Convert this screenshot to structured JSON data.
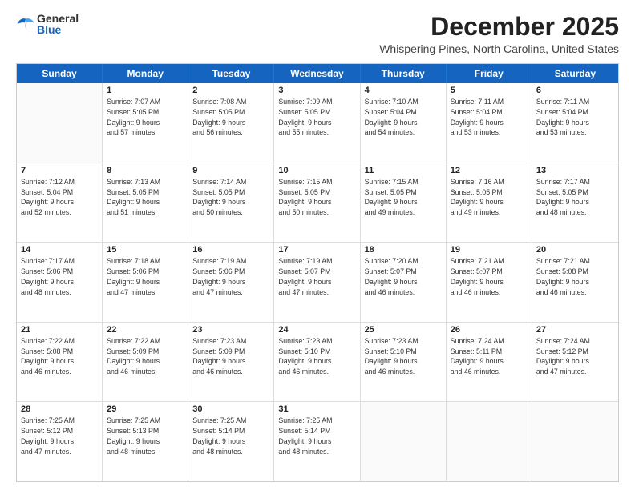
{
  "logo": {
    "general": "General",
    "blue": "Blue"
  },
  "title": "December 2025",
  "location": "Whispering Pines, North Carolina, United States",
  "days_of_week": [
    "Sunday",
    "Monday",
    "Tuesday",
    "Wednesday",
    "Thursday",
    "Friday",
    "Saturday"
  ],
  "weeks": [
    [
      {
        "day": "",
        "info": ""
      },
      {
        "day": "1",
        "info": "Sunrise: 7:07 AM\nSunset: 5:05 PM\nDaylight: 9 hours\nand 57 minutes."
      },
      {
        "day": "2",
        "info": "Sunrise: 7:08 AM\nSunset: 5:05 PM\nDaylight: 9 hours\nand 56 minutes."
      },
      {
        "day": "3",
        "info": "Sunrise: 7:09 AM\nSunset: 5:05 PM\nDaylight: 9 hours\nand 55 minutes."
      },
      {
        "day": "4",
        "info": "Sunrise: 7:10 AM\nSunset: 5:04 PM\nDaylight: 9 hours\nand 54 minutes."
      },
      {
        "day": "5",
        "info": "Sunrise: 7:11 AM\nSunset: 5:04 PM\nDaylight: 9 hours\nand 53 minutes."
      },
      {
        "day": "6",
        "info": "Sunrise: 7:11 AM\nSunset: 5:04 PM\nDaylight: 9 hours\nand 53 minutes."
      }
    ],
    [
      {
        "day": "7",
        "info": "Sunrise: 7:12 AM\nSunset: 5:04 PM\nDaylight: 9 hours\nand 52 minutes."
      },
      {
        "day": "8",
        "info": "Sunrise: 7:13 AM\nSunset: 5:05 PM\nDaylight: 9 hours\nand 51 minutes."
      },
      {
        "day": "9",
        "info": "Sunrise: 7:14 AM\nSunset: 5:05 PM\nDaylight: 9 hours\nand 50 minutes."
      },
      {
        "day": "10",
        "info": "Sunrise: 7:15 AM\nSunset: 5:05 PM\nDaylight: 9 hours\nand 50 minutes."
      },
      {
        "day": "11",
        "info": "Sunrise: 7:15 AM\nSunset: 5:05 PM\nDaylight: 9 hours\nand 49 minutes."
      },
      {
        "day": "12",
        "info": "Sunrise: 7:16 AM\nSunset: 5:05 PM\nDaylight: 9 hours\nand 49 minutes."
      },
      {
        "day": "13",
        "info": "Sunrise: 7:17 AM\nSunset: 5:05 PM\nDaylight: 9 hours\nand 48 minutes."
      }
    ],
    [
      {
        "day": "14",
        "info": "Sunrise: 7:17 AM\nSunset: 5:06 PM\nDaylight: 9 hours\nand 48 minutes."
      },
      {
        "day": "15",
        "info": "Sunrise: 7:18 AM\nSunset: 5:06 PM\nDaylight: 9 hours\nand 47 minutes."
      },
      {
        "day": "16",
        "info": "Sunrise: 7:19 AM\nSunset: 5:06 PM\nDaylight: 9 hours\nand 47 minutes."
      },
      {
        "day": "17",
        "info": "Sunrise: 7:19 AM\nSunset: 5:07 PM\nDaylight: 9 hours\nand 47 minutes."
      },
      {
        "day": "18",
        "info": "Sunrise: 7:20 AM\nSunset: 5:07 PM\nDaylight: 9 hours\nand 46 minutes."
      },
      {
        "day": "19",
        "info": "Sunrise: 7:21 AM\nSunset: 5:07 PM\nDaylight: 9 hours\nand 46 minutes."
      },
      {
        "day": "20",
        "info": "Sunrise: 7:21 AM\nSunset: 5:08 PM\nDaylight: 9 hours\nand 46 minutes."
      }
    ],
    [
      {
        "day": "21",
        "info": "Sunrise: 7:22 AM\nSunset: 5:08 PM\nDaylight: 9 hours\nand 46 minutes."
      },
      {
        "day": "22",
        "info": "Sunrise: 7:22 AM\nSunset: 5:09 PM\nDaylight: 9 hours\nand 46 minutes."
      },
      {
        "day": "23",
        "info": "Sunrise: 7:23 AM\nSunset: 5:09 PM\nDaylight: 9 hours\nand 46 minutes."
      },
      {
        "day": "24",
        "info": "Sunrise: 7:23 AM\nSunset: 5:10 PM\nDaylight: 9 hours\nand 46 minutes."
      },
      {
        "day": "25",
        "info": "Sunrise: 7:23 AM\nSunset: 5:10 PM\nDaylight: 9 hours\nand 46 minutes."
      },
      {
        "day": "26",
        "info": "Sunrise: 7:24 AM\nSunset: 5:11 PM\nDaylight: 9 hours\nand 46 minutes."
      },
      {
        "day": "27",
        "info": "Sunrise: 7:24 AM\nSunset: 5:12 PM\nDaylight: 9 hours\nand 47 minutes."
      }
    ],
    [
      {
        "day": "28",
        "info": "Sunrise: 7:25 AM\nSunset: 5:12 PM\nDaylight: 9 hours\nand 47 minutes."
      },
      {
        "day": "29",
        "info": "Sunrise: 7:25 AM\nSunset: 5:13 PM\nDaylight: 9 hours\nand 48 minutes."
      },
      {
        "day": "30",
        "info": "Sunrise: 7:25 AM\nSunset: 5:14 PM\nDaylight: 9 hours\nand 48 minutes."
      },
      {
        "day": "31",
        "info": "Sunrise: 7:25 AM\nSunset: 5:14 PM\nDaylight: 9 hours\nand 48 minutes."
      },
      {
        "day": "",
        "info": ""
      },
      {
        "day": "",
        "info": ""
      },
      {
        "day": "",
        "info": ""
      }
    ]
  ]
}
